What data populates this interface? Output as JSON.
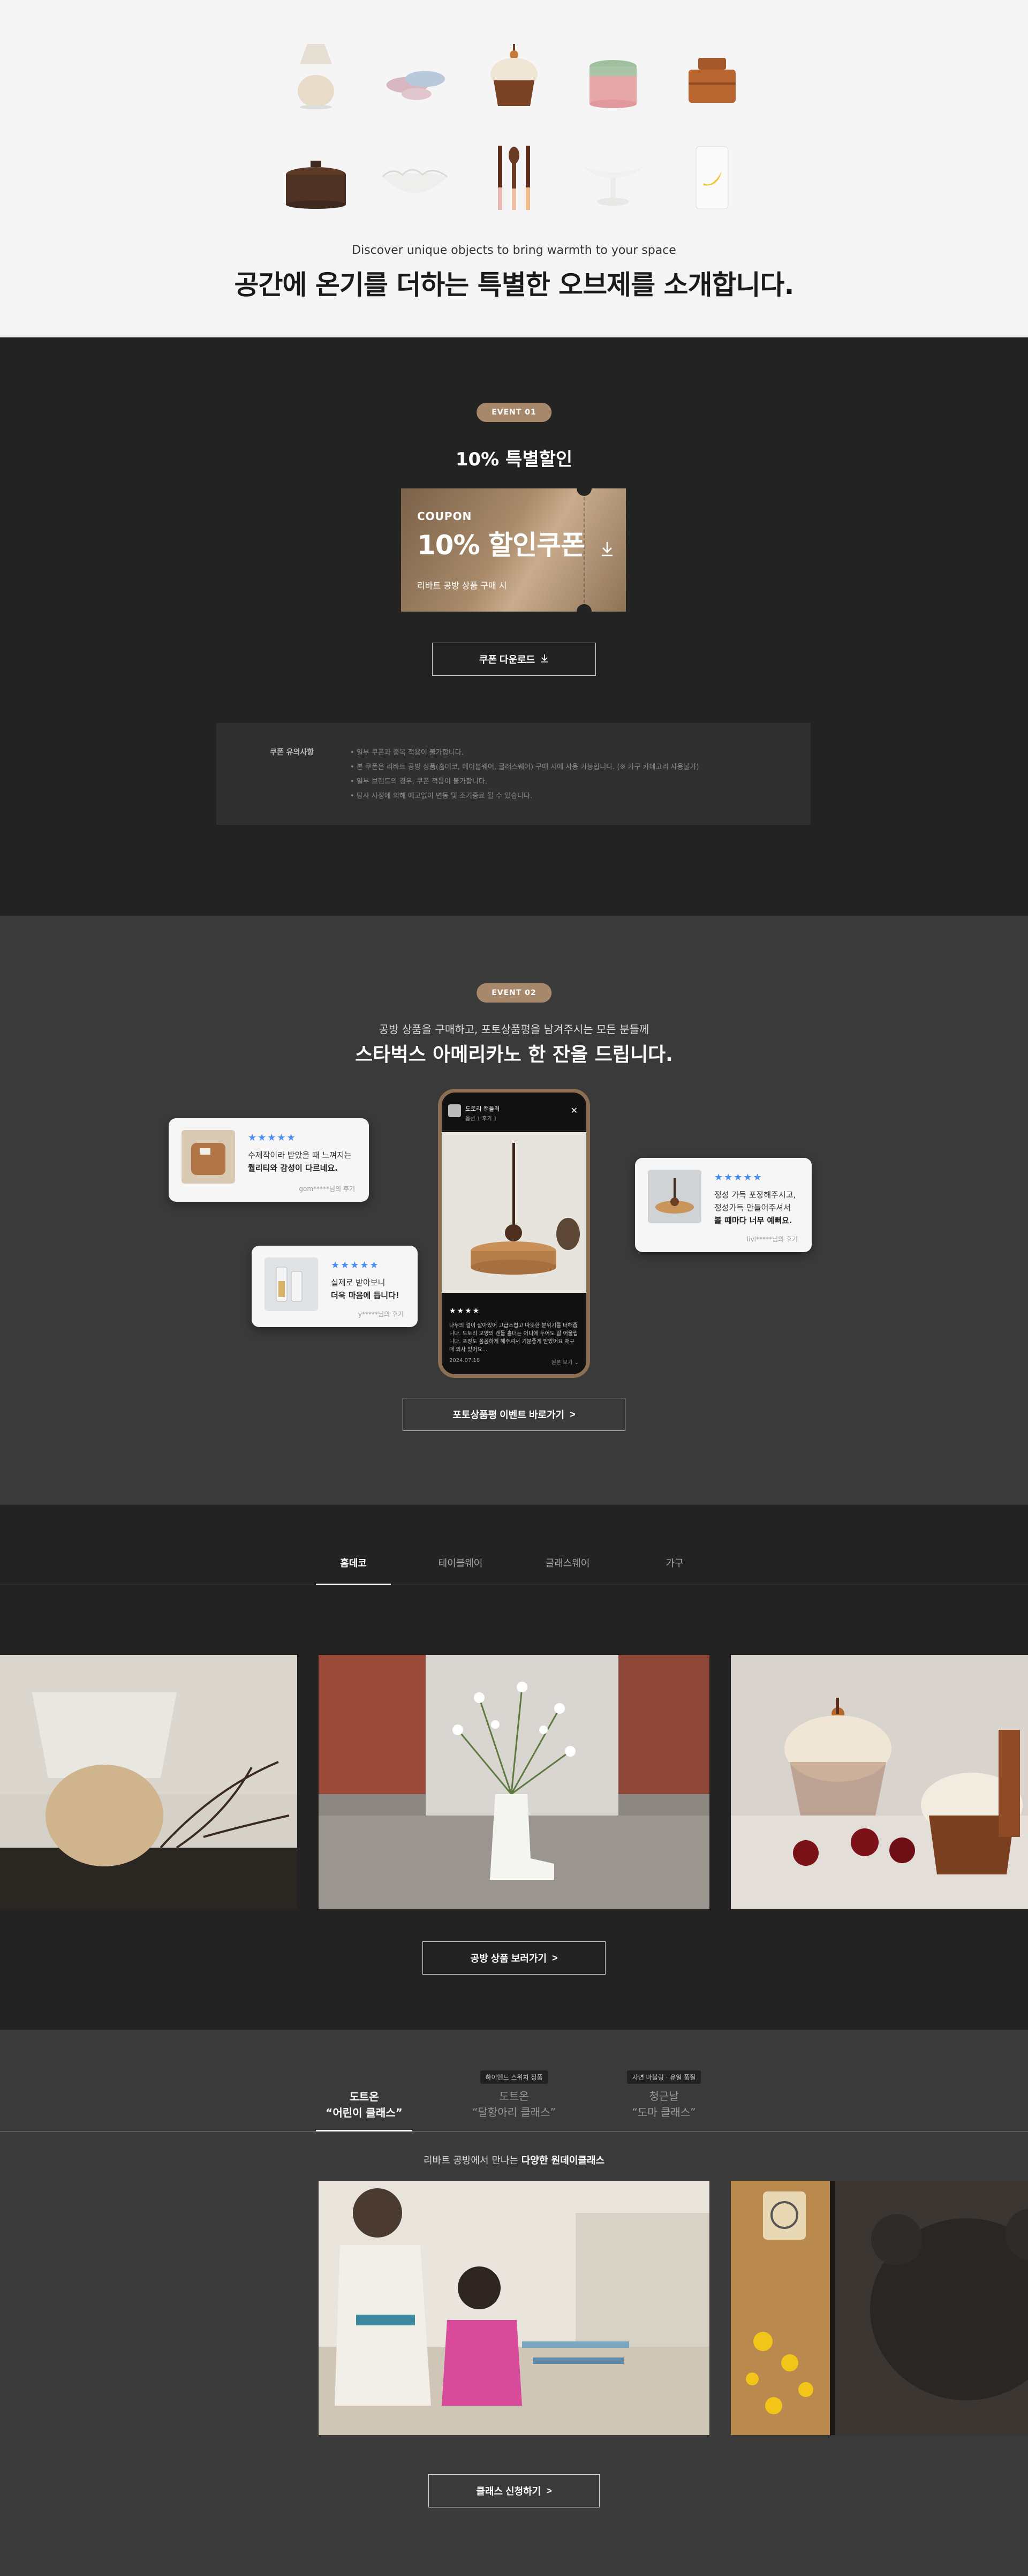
{
  "hero": {
    "subtitle": "Discover unique objects to bring warmth to your space",
    "title": "공간에 온기를 더하는 특별한 오브제를 소개합니다."
  },
  "event1": {
    "badge": "EVENT 01",
    "title": "10% 특별할인",
    "coupon": {
      "label": "COUPON",
      "amount": "10% 할인쿠폰",
      "description": "리바트 공방 상품 구매 시"
    },
    "download_button": "쿠폰 다운로드",
    "notice": {
      "title": "쿠폰 유의사항",
      "items": [
        "일부 쿠폰과 중복 적용이 불가합니다.",
        "본 쿠폰은 리바트 공방 상품(홈데코, 테이블웨어, 글래스웨어) 구매 시에 사용 가능합니다. (※ 가구 카테고리 사용불가)",
        "일부 브랜드의 경우, 쿠폰 적용이 불가합니다.",
        "당사 사정에 의해 예고없이 변동 및 조기종료 될 수 있습니다."
      ]
    }
  },
  "event2": {
    "badge": "EVENT 02",
    "subtitle": "공방 상품을 구매하고, 포토상품평을 남겨주시는 모든 분들께",
    "title": "스타벅스 아메리카노 한 잔을 드립니다.",
    "reviews": [
      {
        "stars": "★★★★★",
        "line1": "수제작이라 받았을 때 느껴지는",
        "line2": "퀄리티와 감성이 다르네요.",
        "author": "gom*****님의 후기"
      },
      {
        "stars": "★★★★★",
        "line1": "실제로 받아보니",
        "line2": "더욱 마음에 듭니다!",
        "author": "y*****님의 후기"
      },
      {
        "stars": "★★★★★",
        "line1": "정성 가득 포장해주시고,",
        "line2_a": "정성가득 만들어주셔서",
        "line2": "볼 때마다 너무 예뻐요.",
        "author": "livl*****님의 후기"
      }
    ],
    "phone": {
      "name": "도토리 캔들러",
      "meta": "옵션 1   후기 1",
      "stars": "★★★★",
      "text": "나무의 결이 살아있어 고급스럽고 따뜻한 분위기를 더해줍니다. 도토리 모양의 캔들 홀더는 어디에 두어도 잘 어울립니다. 포장도 꼼꼼하게 해주셔서 기분좋게 받았어요 재구매 의사 있어요...",
      "date": "2024.07.18",
      "more": "원본 보기 ⌄"
    },
    "button": "포토상품평 이벤트 바로가기"
  },
  "category": {
    "tabs": [
      "홈데코",
      "테이블웨어",
      "글래스웨어",
      "가구"
    ],
    "button": "공방 상품 보러가기"
  },
  "classes": {
    "tabs": [
      {
        "tag": "",
        "line1": "도트온",
        "line2": "“어린이 클래스”"
      },
      {
        "tag": "하이엔드 스위치 정품",
        "line1": "도트온",
        "line2": "“달항아리 클래스”"
      },
      {
        "tag": "자연 마블링 · 유일 품질",
        "line1": "청근날",
        "line2": "“도마 클래스”"
      }
    ],
    "subtitle_a": "리바트 공방에서 만나는",
    "subtitle_b": "다양한 원데이클래스",
    "button": "클래스 신청하기"
  },
  "icons": {
    "download": "download-icon",
    "arrow": "chevron-right-icon",
    "close": "close-icon"
  },
  "colors": {
    "accent": "#a7886a",
    "dark_bg": "#232323",
    "mid_bg": "#3a3a3a",
    "stars": "#4a8df6"
  }
}
